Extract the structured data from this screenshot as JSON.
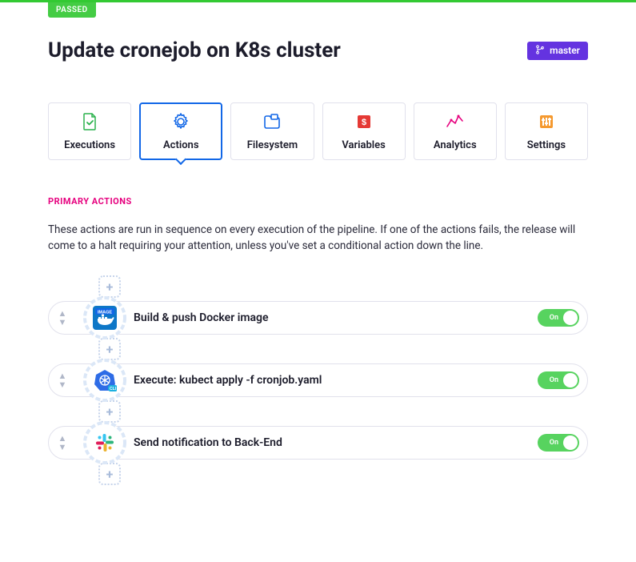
{
  "status_badge": "PASSED",
  "page_title": "Update cronejob on K8s cluster",
  "branch": {
    "label": "master"
  },
  "tabs": [
    {
      "label": "Executions"
    },
    {
      "label": "Actions"
    },
    {
      "label": "Filesystem"
    },
    {
      "label": "Variables"
    },
    {
      "label": "Analytics"
    },
    {
      "label": "Settings"
    }
  ],
  "active_tab": 1,
  "section": {
    "title": "PRIMARY ACTIONS",
    "description": "These actions are run in sequence on every execution of the pipeline. If one of the actions fails, the release will come to a halt requiring your attention, unless you've set a conditional action down the line."
  },
  "actions": [
    {
      "label": "Build & push Docker image",
      "toggle": "On",
      "icon": "docker"
    },
    {
      "label": "Execute: kubect apply -f cronjob.yaml",
      "toggle": "On",
      "icon": "kubernetes"
    },
    {
      "label": "Send notification to Back-End",
      "toggle": "On",
      "icon": "slack"
    }
  ]
}
